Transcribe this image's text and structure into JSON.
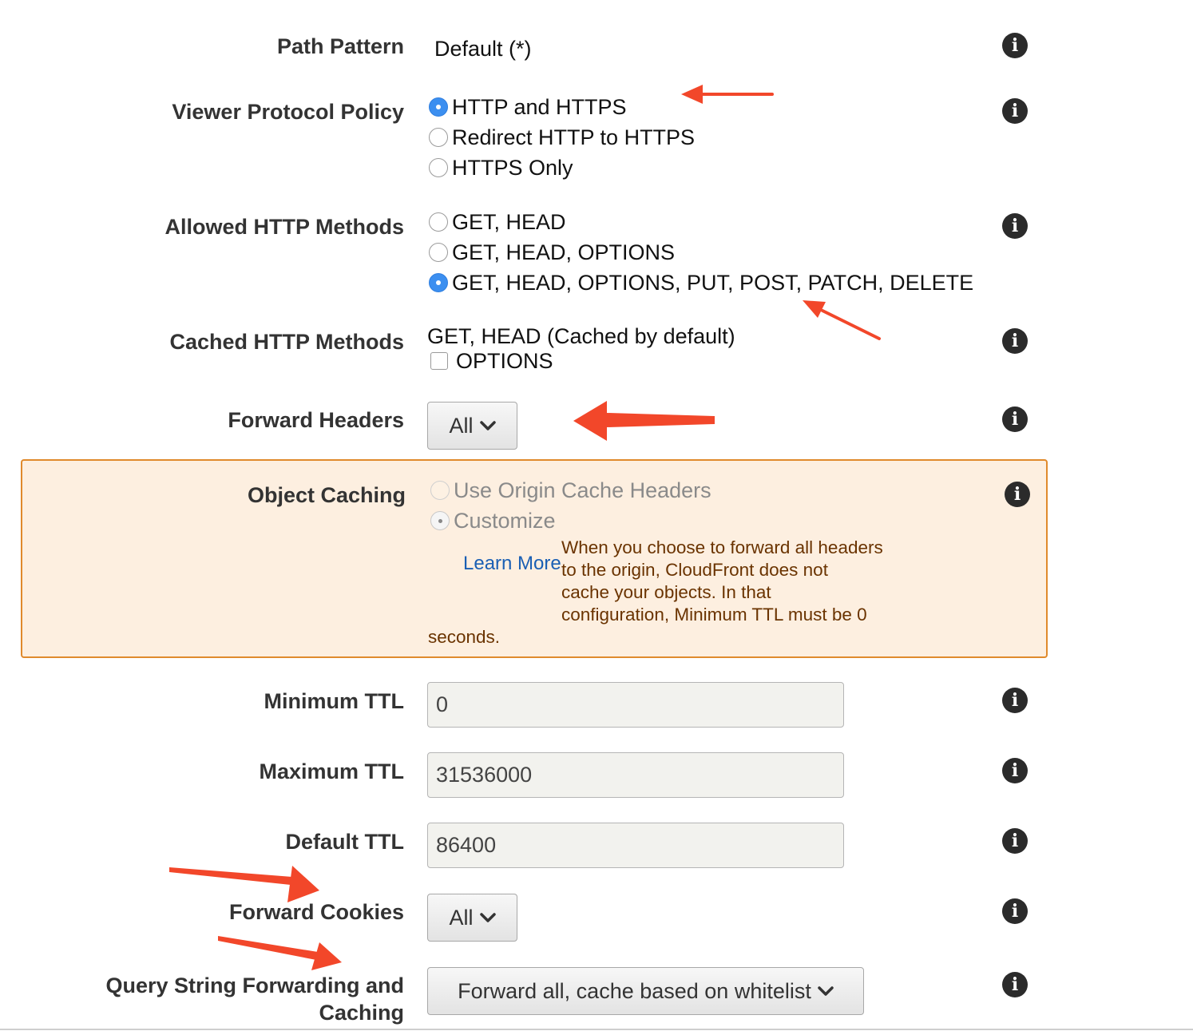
{
  "info_icon": "i",
  "path_pattern": {
    "label": "Path Pattern",
    "value": "Default (*)"
  },
  "viewer_protocol": {
    "label": "Viewer Protocol Policy",
    "options": [
      "HTTP and HTTPS",
      "Redirect HTTP to HTTPS",
      "HTTPS Only"
    ],
    "selected": "HTTP and HTTPS"
  },
  "allowed_methods": {
    "label": "Allowed HTTP Methods",
    "options": [
      "GET, HEAD",
      "GET, HEAD, OPTIONS",
      "GET, HEAD, OPTIONS, PUT, POST, PATCH, DELETE"
    ],
    "selected": "GET, HEAD, OPTIONS, PUT, POST, PATCH, DELETE"
  },
  "cached_methods": {
    "label": "Cached HTTP Methods",
    "default_text": "GET, HEAD (Cached by default)",
    "options_checkbox": "OPTIONS",
    "options_checked": false
  },
  "forward_headers": {
    "label": "Forward Headers",
    "value": "All"
  },
  "object_caching": {
    "label": "Object Caching",
    "options": [
      "Use Origin Cache Headers",
      "Customize"
    ],
    "selected": "Customize",
    "learn_more": "Learn More",
    "warning_lines": [
      "When you choose to forward all headers",
      "to the origin, CloudFront does not",
      "cache your objects. In that",
      "configuration, Minimum TTL must be 0"
    ],
    "warning_tail": "seconds."
  },
  "minimum_ttl": {
    "label": "Minimum TTL",
    "value": "0"
  },
  "maximum_ttl": {
    "label": "Maximum TTL",
    "value": "31536000"
  },
  "default_ttl": {
    "label": "Default TTL",
    "value": "86400"
  },
  "forward_cookies": {
    "label": "Forward Cookies",
    "value": "All"
  },
  "query_string": {
    "label_line1": "Query String Forwarding and",
    "label_line2": "Caching",
    "value": "Forward all, cache based on whitelist"
  },
  "annotation_color": "#f2472a"
}
